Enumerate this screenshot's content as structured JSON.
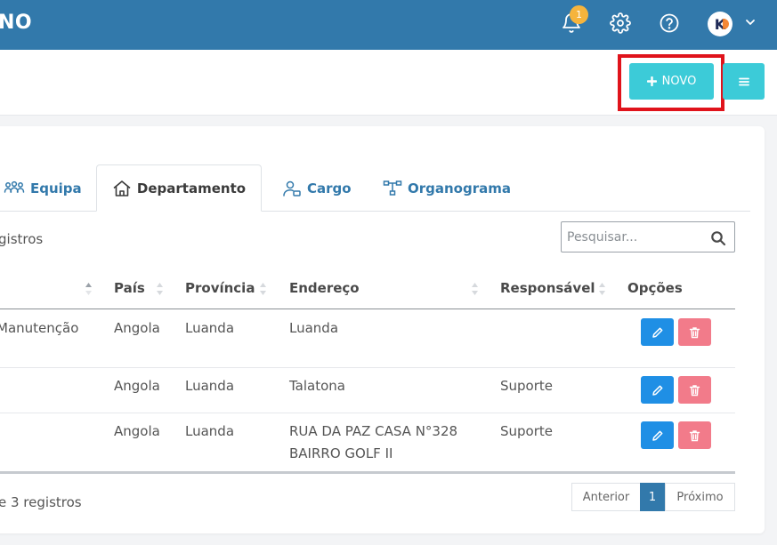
{
  "header": {
    "brand": "NO",
    "notifications_count": "1",
    "avatar_letter": "K"
  },
  "toolbar": {
    "new_label": "NOVO"
  },
  "tabs": [
    {
      "label": "Equipa"
    },
    {
      "label": "Departamento"
    },
    {
      "label": "Cargo"
    },
    {
      "label": "Organograma"
    }
  ],
  "list": {
    "registros_top": "gistros",
    "search_placeholder": "Pesquisar...",
    "registros_bottom": "e 3 registros"
  },
  "table": {
    "headers": [
      "País",
      "Província",
      "Endereço",
      "Responsável",
      "Opções"
    ],
    "rows": [
      {
        "nome": "Manutenção",
        "pais": "Angola",
        "provincia": "Luanda",
        "endereco": "Luanda",
        "responsavel": ""
      },
      {
        "nome": "",
        "pais": "Angola",
        "provincia": "Luanda",
        "endereco": "Talatona",
        "responsavel": "Suporte"
      },
      {
        "nome": "",
        "pais": "Angola",
        "provincia": "Luanda",
        "endereco": "RUA DA PAZ CASA N°328 BAIRRO GOLF II",
        "responsavel": "Suporte"
      }
    ]
  },
  "pagination": {
    "prev": "Anterior",
    "current": "1",
    "next": "Próximo"
  },
  "colors": {
    "header_bg": "#3279ab",
    "accent": "#3ccbd8",
    "edit": "#1f8fe5",
    "delete": "#f27b8a",
    "highlight": "#e0131b"
  }
}
